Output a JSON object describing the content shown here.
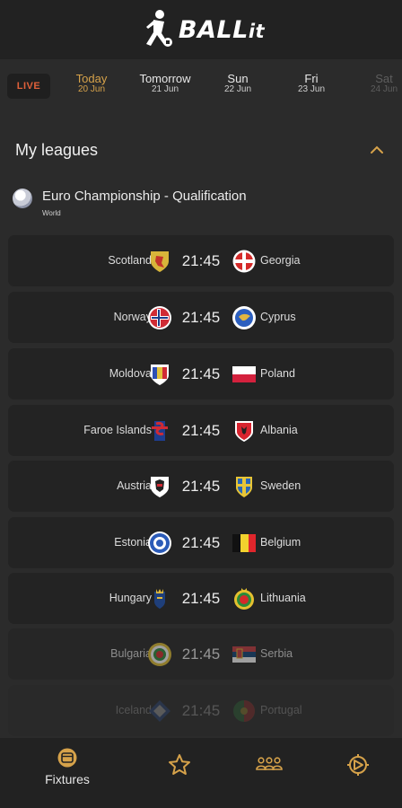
{
  "app": {
    "name": "BALL",
    "name_suffix": "it"
  },
  "datebar": {
    "live_label": "LIVE",
    "days": [
      {
        "name": "Today",
        "date": "20 Jun",
        "state": "active"
      },
      {
        "name": "Tomorrow",
        "date": "21 Jun",
        "state": "normal"
      },
      {
        "name": "Sun",
        "date": "22 Jun",
        "state": "normal"
      },
      {
        "name": "Fri",
        "date": "23 Jun",
        "state": "normal"
      },
      {
        "name": "Sat",
        "date": "24 Jun",
        "state": "faded"
      }
    ]
  },
  "section": {
    "title": "My leagues"
  },
  "league": {
    "name": "Euro Championship - Qualification",
    "region": "World"
  },
  "matches": [
    {
      "home": "Scotland",
      "time": "21:45",
      "away": "Georgia"
    },
    {
      "home": "Norway",
      "time": "21:45",
      "away": "Cyprus"
    },
    {
      "home": "Moldova",
      "time": "21:45",
      "away": "Poland"
    },
    {
      "home": "Faroe Islands",
      "time": "21:45",
      "away": "Albania"
    },
    {
      "home": "Austria",
      "time": "21:45",
      "away": "Sweden"
    },
    {
      "home": "Estonia",
      "time": "21:45",
      "away": "Belgium"
    },
    {
      "home": "Hungary",
      "time": "21:45",
      "away": "Lithuania"
    },
    {
      "home": "Bulgaria",
      "time": "21:45",
      "away": "Serbia"
    },
    {
      "home": "Iceland",
      "time": "21:45",
      "away": "Portugal"
    }
  ],
  "bottom_nav": {
    "fixtures_label": "Fixtures",
    "items": [
      "fixtures-icon",
      "star-icon",
      "teams-icon",
      "settings-icon"
    ]
  },
  "colors": {
    "accent": "#d6a24a",
    "live": "#e0603a",
    "background": "#2b2b2b",
    "card": "#232323",
    "bar": "#222222"
  }
}
